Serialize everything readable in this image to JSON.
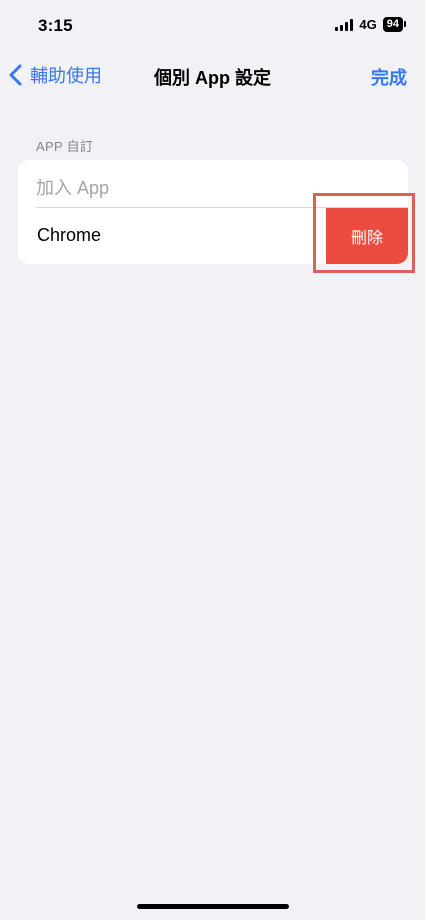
{
  "status_bar": {
    "time": "3:15",
    "network": "4G",
    "battery": "94"
  },
  "nav": {
    "back_label": "輔助使用",
    "title": "個別 App 設定",
    "done_label": "完成"
  },
  "section": {
    "header": "APP 自訂",
    "add_app_label": "加入 App",
    "items": [
      {
        "label": "Chrome",
        "delete_label": "刪除"
      }
    ]
  },
  "colors": {
    "accent": "#3478f6",
    "destructive": "#eb4c3f",
    "background": "#f2f1f6",
    "highlight": "#d9625c"
  }
}
